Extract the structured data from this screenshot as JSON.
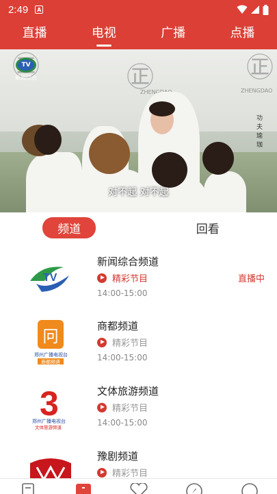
{
  "status_bar": {
    "time": "2:49",
    "notification_badge": "A"
  },
  "top_nav": {
    "tabs": [
      {
        "label": "直播",
        "active": false
      },
      {
        "label": "电视",
        "active": true
      },
      {
        "label": "广播",
        "active": false
      },
      {
        "label": "点播",
        "active": false
      }
    ]
  },
  "player": {
    "subtitle": "对不起 对不起",
    "channel_logo_text": "新闻综合",
    "watermark": "ZHENGDAO",
    "side_text": "功夫瑜珈"
  },
  "sub_tabs": [
    {
      "label": "频道",
      "active": true
    },
    {
      "label": "回看",
      "active": false
    }
  ],
  "channels": [
    {
      "name": "新闻综合频道",
      "program": "精彩节目",
      "time": "14:00-15:00",
      "live_label": "直播中",
      "highlight": true,
      "logo": "tv-logo-icon"
    },
    {
      "name": "商都频道",
      "program": "精彩节目",
      "time": "14:00-15:00",
      "live_label": "",
      "highlight": false,
      "logo": "shangdu-logo-icon",
      "logo_text": "郑州广播电视台",
      "logo_sub": "商都频道"
    },
    {
      "name": "文体旅游频道",
      "program": "精彩节目",
      "time": "14:00-15:00",
      "live_label": "",
      "highlight": false,
      "logo": "wenti-logo-icon",
      "logo_text": "郑州广播电视台",
      "logo_sub": "文体旅游频道"
    },
    {
      "name": "豫剧频道",
      "program": "精彩节目",
      "time": "",
      "live_label": "",
      "highlight": false,
      "logo": "yuju-logo-icon"
    }
  ],
  "bottom_nav": {
    "items": [
      {
        "icon": "news-icon"
      },
      {
        "icon": "tv-icon",
        "active": true
      },
      {
        "icon": "heart-icon"
      },
      {
        "icon": "compass-icon"
      },
      {
        "icon": "profile-icon"
      }
    ]
  },
  "colors": {
    "brand_red": "#dc3f35",
    "accent_red": "#d33a31"
  }
}
